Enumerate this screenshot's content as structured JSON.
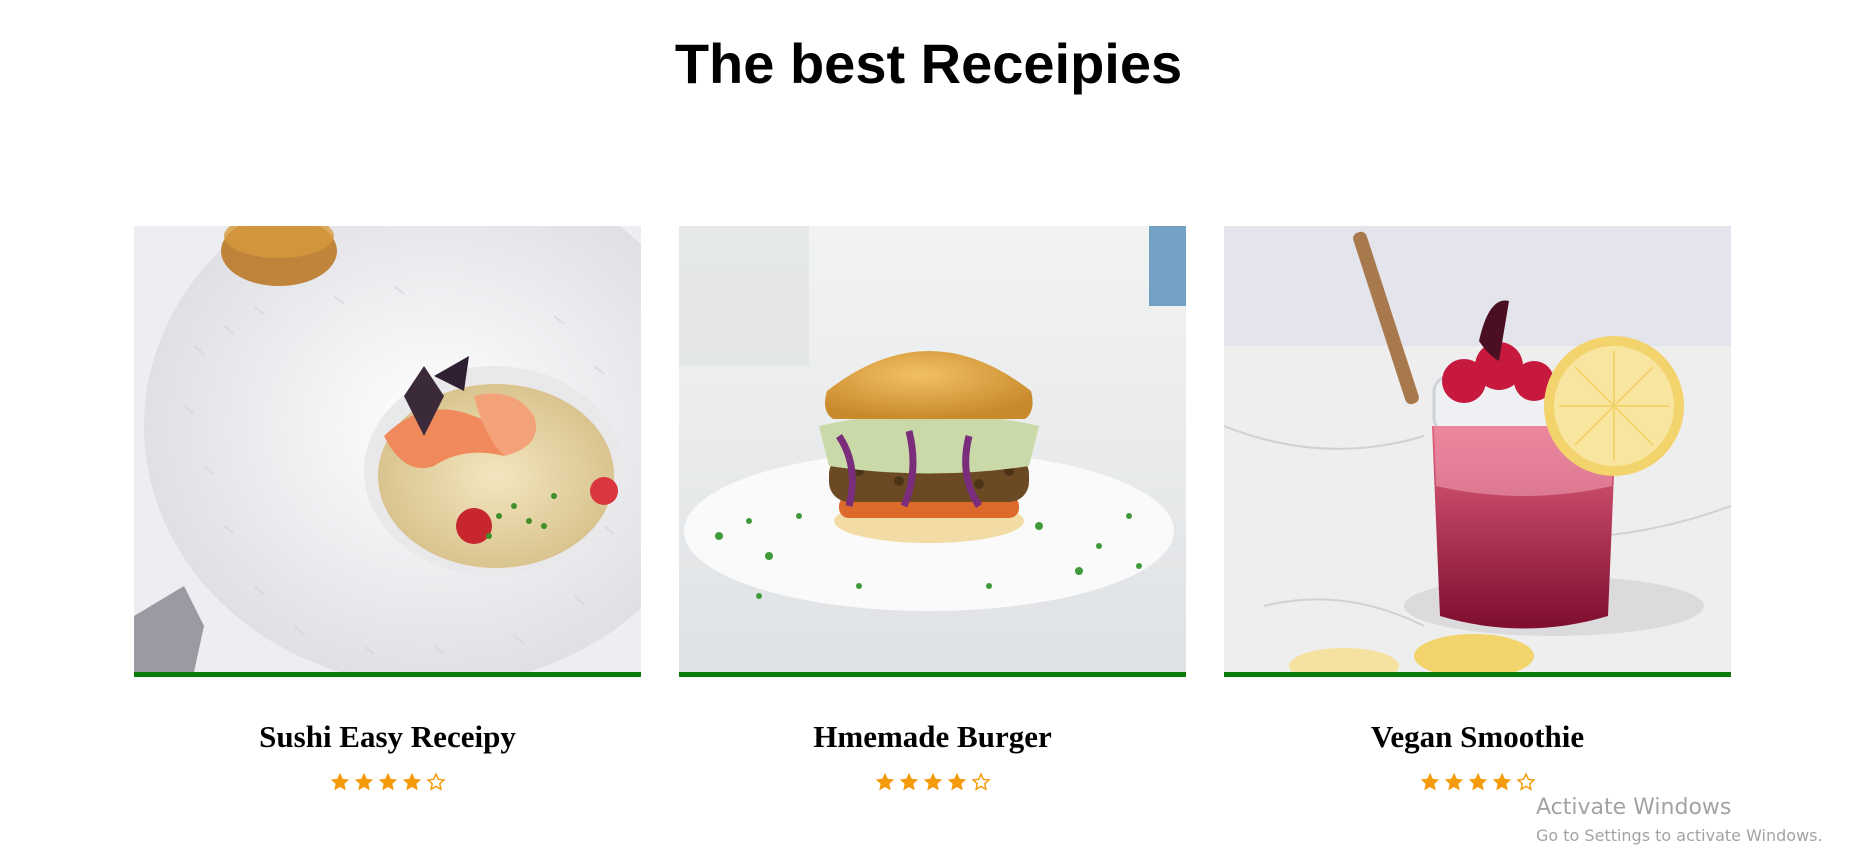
{
  "page": {
    "title": "The best Receipies"
  },
  "cards": [
    {
      "title": "Sushi Easy Receipy",
      "image": "shrimp-dish-photo",
      "rating": 4,
      "rating_max": 5
    },
    {
      "title": "Hmemade Burger",
      "image": "burger-photo",
      "rating": 4,
      "rating_max": 5
    },
    {
      "title": "Vegan Smoothie",
      "image": "berry-smoothie-photo",
      "rating": 4,
      "rating_max": 5
    }
  ],
  "colors": {
    "accent_border": "#0d7a0d",
    "star": "#f59a0b"
  },
  "watermark": {
    "title": "Activate Windows",
    "subtitle": "Go to Settings to activate Windows."
  }
}
